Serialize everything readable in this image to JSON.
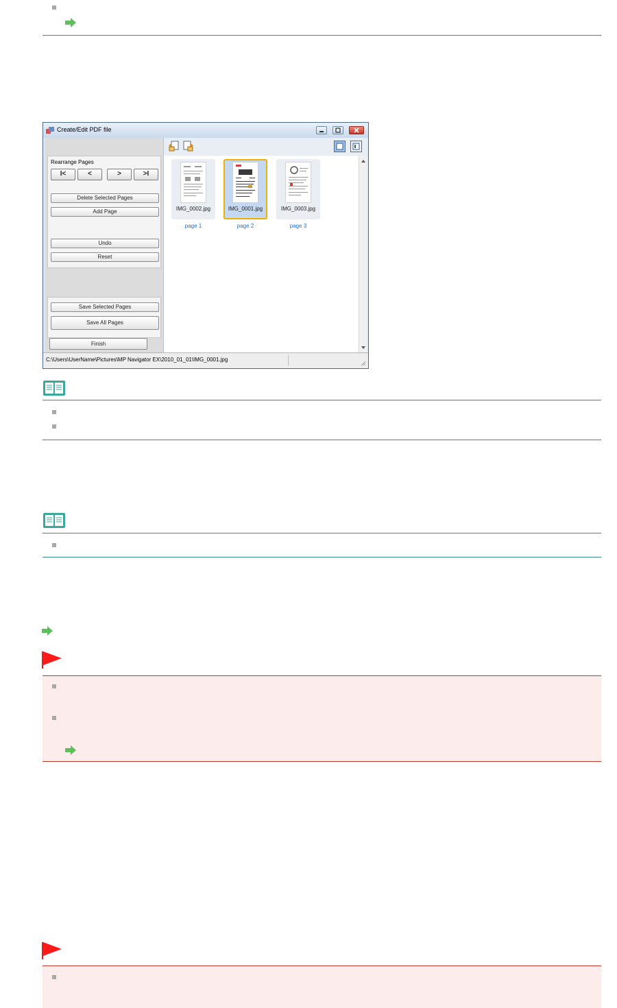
{
  "dialog": {
    "title": "Create/Edit PDF file",
    "rearrange_title": "Rearrange Pages",
    "nav_first": "I<",
    "nav_prev": "<",
    "nav_next": ">",
    "nav_last": ">I",
    "delete_selected_label": "Delete Selected Pages",
    "add_page_label": "Add Page",
    "undo_label": "Undo",
    "reset_label": "Reset",
    "save_selected_label": "Save Selected Pages",
    "save_all_label": "Save All Pages",
    "finish_label": "Finish",
    "status_path": "C:\\Users\\UserName\\Pictures\\MP Navigator EX\\2010_01_01\\IMG_0001.jpg",
    "thumbnails": [
      {
        "filename": "IMG_0002.jpg",
        "page_label": "page 1",
        "selected": false
      },
      {
        "filename": "IMG_0001.jpg",
        "page_label": "page 2",
        "selected": true
      },
      {
        "filename": "IMG_0003.jpg",
        "page_label": "page 3",
        "selected": false
      }
    ]
  },
  "icons": {
    "bullet": "square-bullet-icon",
    "link": "green-arrow-icon",
    "note": "open-book-icon",
    "important": "red-flag-icon"
  },
  "colors": {
    "rule": "#3a8a94",
    "caution_rule": "#c0392b",
    "caution_bg": "#fdecec",
    "link_arrow": "#5dc05b",
    "page_label": "#1b6fd6",
    "selection_border": "#f0b000"
  }
}
